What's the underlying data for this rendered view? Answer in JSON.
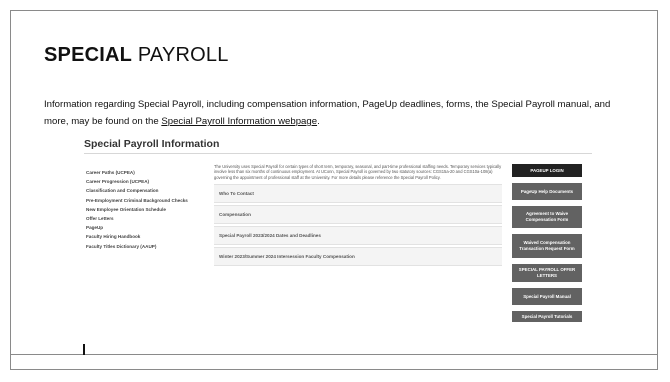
{
  "slide": {
    "title_bold": "SPECIAL",
    "title_rest": " PAYROLL",
    "intro_text": "Information regarding Special Payroll, including compensation information, PageUp deadlines, forms, the Special Payroll manual, and more, may be found on the ",
    "intro_link": "Special Payroll Information webpage",
    "intro_end": "."
  },
  "screenshot": {
    "page_title": "Special Payroll Information",
    "sidebar_links": [
      "Career Paths (UCPEA)",
      "Career Progression (UCPEA)",
      "Classification and Compensation",
      "Pre-Employment Criminal Background Checks",
      "New Employee Orientation Schedule",
      "Offer Letters",
      "PageUp",
      "Faculty Hiring Handbook",
      "Faculty Titles Dictionary (AAUP)"
    ],
    "description": "The University uses Special Payroll for certain types of short term, temporary, seasonal, and part-time professional staffing needs. Temporary services typically involve less than six months of continuous employment. At UConn, Special Payroll is governed by two statutory sources: CGS15a-20 and CGS10a-108(a) governing the appointment of professional staff at the University. For more details please reference the Special Payroll Policy.",
    "accordion": [
      "Who To Contact",
      "Compensation",
      "Special Payroll 2023/2024 Dates and Deadlines",
      "Winter 2023/Summer 2024 Intersession Faculty Compensation"
    ],
    "buttons": [
      "PAGEUP LOGIN",
      "PageUp Help Documents",
      "Agreement to Waive Compensation Form",
      "Waived Compensation Transaction Request Form",
      "SPECIAL PAYROLL OFFER LETTERS",
      "Special Payroll Manual",
      "Special Payroll Tutorials"
    ]
  },
  "colors": {
    "button_gray": "#626262",
    "button_dark": "#222222",
    "frame": "#8a8a8a"
  }
}
